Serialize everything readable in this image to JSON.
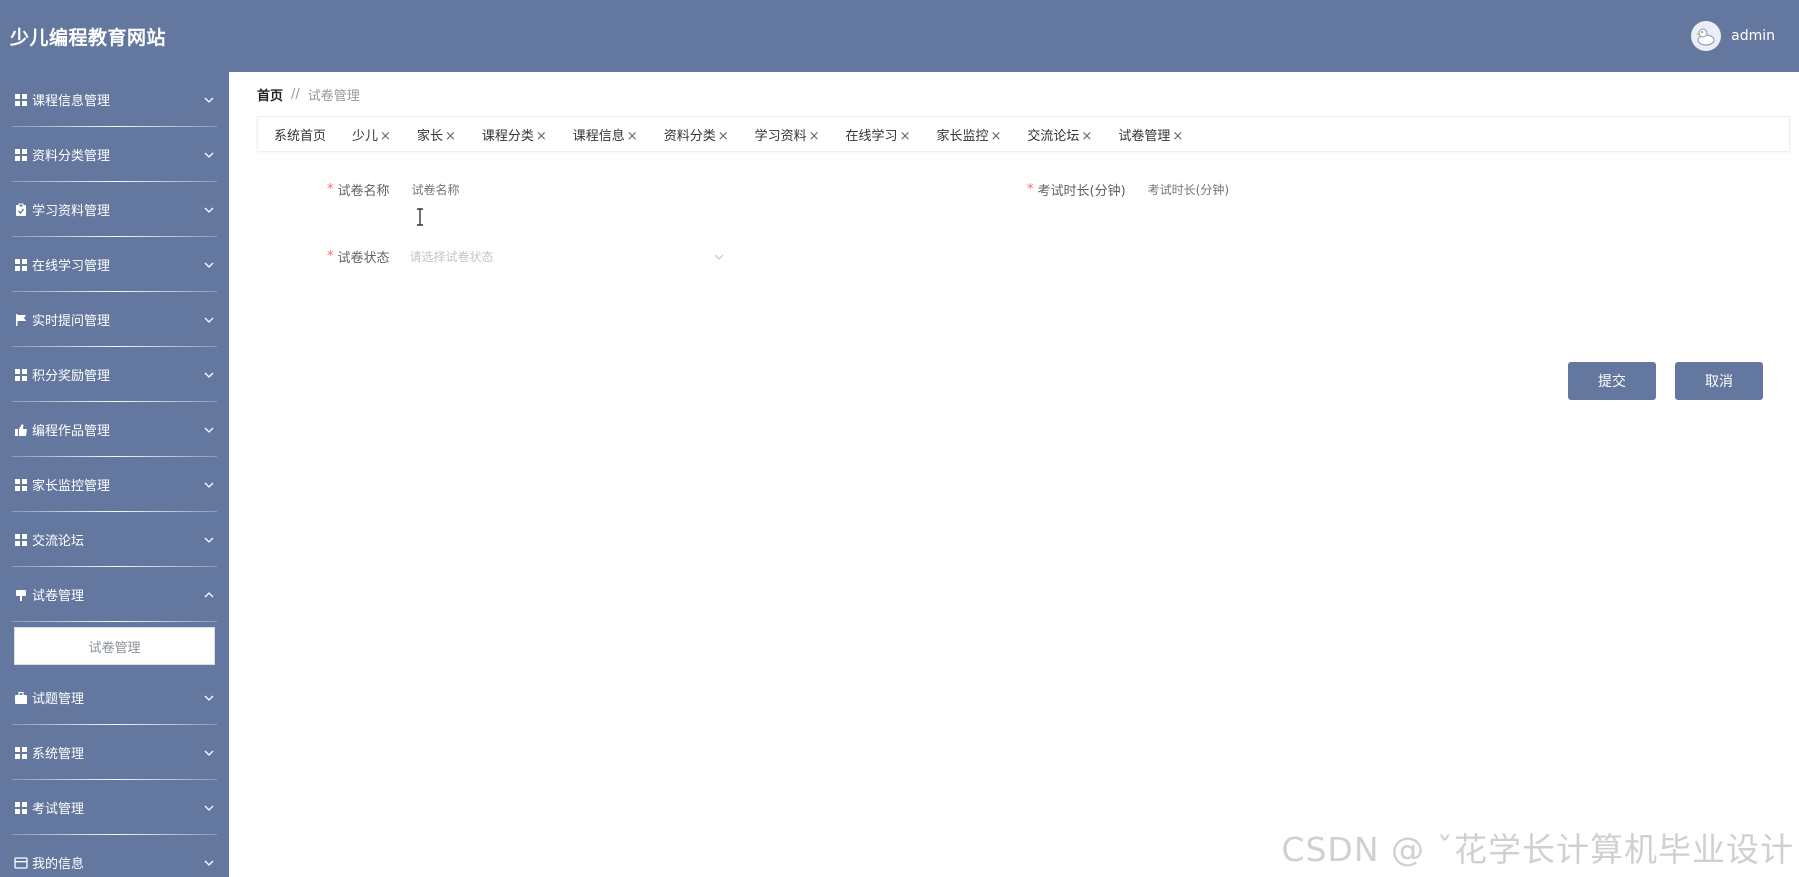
{
  "header": {
    "title": "少儿编程教育网站",
    "username": "admin"
  },
  "sidebar": {
    "items": [
      {
        "label": "课程信息管理",
        "icon": "grid-icon"
      },
      {
        "label": "资料分类管理",
        "icon": "grid-icon"
      },
      {
        "label": "学习资料管理",
        "icon": "clipboard-icon"
      },
      {
        "label": "在线学习管理",
        "icon": "grid-icon"
      },
      {
        "label": "实时提问管理",
        "icon": "flag-icon"
      },
      {
        "label": "积分奖励管理",
        "icon": "grid-icon"
      },
      {
        "label": "编程作品管理",
        "icon": "thumbs-up-icon"
      },
      {
        "label": "家长监控管理",
        "icon": "grid-icon"
      },
      {
        "label": "交流论坛",
        "icon": "grid-icon"
      },
      {
        "label": "试卷管理",
        "icon": "pin-icon",
        "expanded": true
      },
      {
        "label": "试题管理",
        "icon": "briefcase-icon"
      },
      {
        "label": "系统管理",
        "icon": "grid-icon"
      },
      {
        "label": "考试管理",
        "icon": "grid-icon"
      },
      {
        "label": "我的信息",
        "icon": "card-icon"
      }
    ],
    "submenu": {
      "label": "试卷管理"
    }
  },
  "breadcrumb": {
    "home": "首页",
    "separator": "//",
    "current": "试卷管理"
  },
  "tabs": [
    {
      "label": "系统首页",
      "closable": false
    },
    {
      "label": "少儿",
      "closable": true
    },
    {
      "label": "家长",
      "closable": true
    },
    {
      "label": "课程分类",
      "closable": true
    },
    {
      "label": "课程信息",
      "closable": true
    },
    {
      "label": "资料分类",
      "closable": true
    },
    {
      "label": "学习资料",
      "closable": true
    },
    {
      "label": "在线学习",
      "closable": true
    },
    {
      "label": "家长监控",
      "closable": true
    },
    {
      "label": "交流论坛",
      "closable": true
    },
    {
      "label": "试卷管理",
      "closable": true
    }
  ],
  "tab_close_glyph": "×",
  "form": {
    "required_mark": "*",
    "name": {
      "label": "试卷名称",
      "placeholder": "试卷名称"
    },
    "duration": {
      "label": "考试时长(分钟)",
      "placeholder": "考试时长(分钟)"
    },
    "status": {
      "label": "试卷状态",
      "placeholder": "请选择试卷状态"
    }
  },
  "buttons": {
    "submit": "提交",
    "cancel": "取消"
  },
  "watermark": "CSDN @ ˇ花学长计算机毕业设计",
  "colors": {
    "primary": "#64789f",
    "required": "#f56c6c"
  }
}
